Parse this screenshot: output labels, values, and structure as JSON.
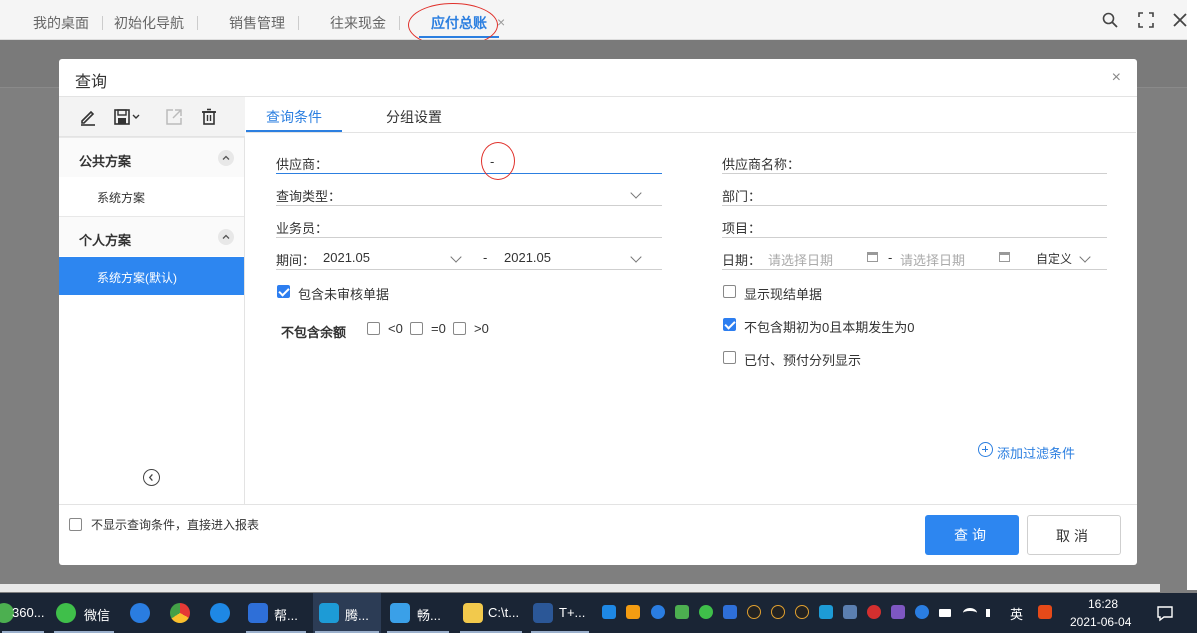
{
  "top_tabs": [
    {
      "label": "我的桌面"
    },
    {
      "label": "初始化导航"
    },
    {
      "label": "销售管理"
    },
    {
      "label": "往来现金"
    },
    {
      "label": "应付总账"
    }
  ],
  "dialog": {
    "title": "查询",
    "close": "×",
    "tabs": [
      {
        "label": "查询条件"
      },
      {
        "label": "分组设置"
      }
    ],
    "sidebar": {
      "groups": [
        {
          "label": "公共方案",
          "items": [
            {
              "label": "系统方案",
              "selected": false
            }
          ]
        },
        {
          "label": "个人方案",
          "items": [
            {
              "label": "系统方案(默认)",
              "selected": true
            }
          ]
        }
      ]
    },
    "form": {
      "supplier_label": "供应商：",
      "supplier_sep": "-",
      "query_type_label": "查询类型：",
      "salesperson_label": "业务员：",
      "period_label": "期间：",
      "period_from": "2021.05",
      "period_sep": "-",
      "period_to": "2021.05",
      "include_unaudited_label": "包含未审核单据",
      "include_unaudited": true,
      "exclude_balance_label": "不包含余额",
      "lt0_label": "<0",
      "eq0_label": "=0",
      "gt0_label": ">0",
      "supplier_name_label": "供应商名称：",
      "department_label": "部门：",
      "project_label": "项目：",
      "date_label": "日期：",
      "date_from_placeholder": "请选择日期",
      "date_sep": "-",
      "date_to_placeholder": "请选择日期",
      "date_mode": "自定义",
      "show_settled_label": "显示现结单据",
      "show_settled": false,
      "exclude_zero_label": "不包含期初为0且本期发生为0",
      "exclude_zero": true,
      "split_paid_label": "已付、预付分列显示",
      "split_paid": false,
      "add_filter_label": "添加过滤条件"
    },
    "footer": {
      "skip_label": "不显示查询条件，直接进入报表",
      "skip": false,
      "query_button": "查询",
      "cancel_button": "取消"
    }
  },
  "taskbar": {
    "apps": [
      {
        "label": "360..."
      },
      {
        "label": "微信"
      },
      {
        "label": "帮..."
      },
      {
        "label": "腾..."
      },
      {
        "label": "畅..."
      },
      {
        "label": "C:\\t..."
      },
      {
        "label": "T+..."
      }
    ],
    "ime": "英",
    "time": "16:28",
    "date": "2021-06-04"
  },
  "colors": {
    "accent": "#2c7fe0",
    "primary_button": "#2d86f0",
    "annotation": "#e0302a"
  }
}
